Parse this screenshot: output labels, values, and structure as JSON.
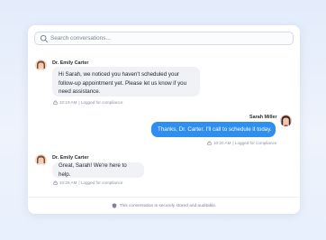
{
  "search": {
    "placeholder": "Search conversations..."
  },
  "messages": [
    {
      "sender": "Dr. Emily Carter",
      "direction": "incoming",
      "lines": [
        "Hi Sarah, we noticed you haven't scheduled your",
        "follow-up appointment yet. Please let us know if you",
        "need assistance."
      ],
      "time": "10:19 AM",
      "meta_note": "| Logged for compliance"
    },
    {
      "sender": "Sarah Miller",
      "direction": "outgoing",
      "lines": [
        "Thanks, Dr. Carter. I'll call to schedule it today."
      ],
      "time": "10:20 AM",
      "meta_note": "| Logged for compliance"
    },
    {
      "sender": "Dr. Emily Carter",
      "direction": "incoming",
      "lines": [
        "Great, Sarah! We're here to help."
      ],
      "time": "10:25 AM",
      "meta_note": "| Logged for compliance"
    }
  ],
  "footer": {
    "notice": "This conversation is securely stored and auditable."
  },
  "colors": {
    "outgoing_bubble": "#2f8ef2",
    "incoming_bubble": "#f0f2f5",
    "page_bg": "#e8f0fd"
  },
  "icons": {
    "search": "search-icon",
    "lock": "lock-icon",
    "shield": "shield-icon"
  }
}
